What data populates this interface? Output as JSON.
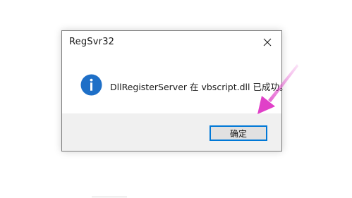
{
  "dialog": {
    "title": "RegSvr32",
    "message": "DllRegisterServer 在 vbscript.dll 已成功。",
    "ok_label": "确定",
    "icon": "info-icon",
    "close_icon": "close-icon"
  },
  "annotation": {
    "icon": "arrow-icon",
    "color": "#e040c8"
  },
  "colors": {
    "info_blue": "#1e6fc7",
    "button_focus": "#0078d7",
    "footer_bg": "#f0f0f0"
  }
}
